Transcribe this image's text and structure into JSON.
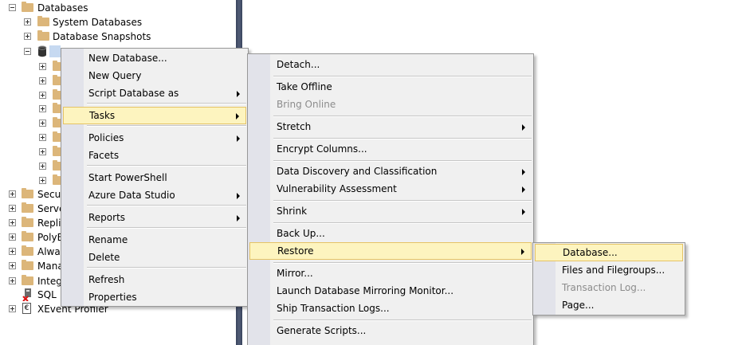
{
  "tree": {
    "nodes": [
      {
        "label": "Databases",
        "expander": "minus",
        "icon": "folder"
      },
      {
        "label": "System Databases",
        "expander": "plus",
        "icon": "folder"
      },
      {
        "label": "Database Snapshots",
        "expander": "plus",
        "icon": "folder"
      },
      {
        "label": "",
        "expander": "minus",
        "icon": "database"
      },
      {
        "label": "",
        "expander": "plus",
        "icon": "folder"
      },
      {
        "label": "",
        "expander": "plus",
        "icon": "folder"
      },
      {
        "label": "",
        "expander": "plus",
        "icon": "folder"
      },
      {
        "label": "",
        "expander": "plus",
        "icon": "folder"
      },
      {
        "label": "",
        "expander": "plus",
        "icon": "folder"
      },
      {
        "label": "",
        "expander": "plus",
        "icon": "folder"
      },
      {
        "label": "",
        "expander": "plus",
        "icon": "folder"
      },
      {
        "label": "",
        "expander": "plus",
        "icon": "folder"
      },
      {
        "label": "",
        "expander": "plus",
        "icon": "folder"
      },
      {
        "label": "Secu",
        "expander": "plus",
        "icon": "folder"
      },
      {
        "label": "Serve",
        "expander": "plus",
        "icon": "folder"
      },
      {
        "label": "Repli",
        "expander": "plus",
        "icon": "folder"
      },
      {
        "label": "PolyB",
        "expander": "plus",
        "icon": "folder"
      },
      {
        "label": "Alwa",
        "expander": "plus",
        "icon": "folder"
      },
      {
        "label": "Mana",
        "expander": "plus",
        "icon": "folder"
      },
      {
        "label": "Integ",
        "expander": "plus",
        "icon": "folder"
      },
      {
        "label": "SQL",
        "expander": "none",
        "icon": "sql-agent-icon"
      },
      {
        "label": "XEvent Profiler",
        "expander": "plus",
        "icon": "xevent-icon"
      }
    ]
  },
  "menu1": {
    "items": [
      {
        "label": "New Database...",
        "submenu": false
      },
      {
        "label": "New Query",
        "submenu": false
      },
      {
        "label": "Script Database as",
        "submenu": true
      },
      {
        "label": "Tasks",
        "submenu": true,
        "highlighted": true
      },
      {
        "label": "Policies",
        "submenu": true
      },
      {
        "label": "Facets",
        "submenu": false
      },
      {
        "label": "Start PowerShell",
        "submenu": false
      },
      {
        "label": "Azure Data Studio",
        "submenu": true
      },
      {
        "label": "Reports",
        "submenu": true
      },
      {
        "label": "Rename",
        "submenu": false
      },
      {
        "label": "Delete",
        "submenu": false
      },
      {
        "label": "Refresh",
        "submenu": false
      },
      {
        "label": "Properties",
        "submenu": false
      }
    ]
  },
  "menu2": {
    "items": [
      {
        "label": "Detach...",
        "submenu": false
      },
      {
        "label": "Take Offline",
        "submenu": false
      },
      {
        "label": "Bring Online",
        "submenu": false,
        "disabled": true
      },
      {
        "label": "Stretch",
        "submenu": true
      },
      {
        "label": "Encrypt Columns...",
        "submenu": false
      },
      {
        "label": "Data Discovery and Classification",
        "submenu": true
      },
      {
        "label": "Vulnerability Assessment",
        "submenu": true
      },
      {
        "label": "Shrink",
        "submenu": true
      },
      {
        "label": "Back Up...",
        "submenu": false
      },
      {
        "label": "Restore",
        "submenu": true,
        "highlighted": true
      },
      {
        "label": "Mirror...",
        "submenu": false
      },
      {
        "label": "Launch Database Mirroring Monitor...",
        "submenu": false
      },
      {
        "label": "Ship Transaction Logs...",
        "submenu": false
      },
      {
        "label": "Generate Scripts...",
        "submenu": false
      }
    ]
  },
  "menu3": {
    "items": [
      {
        "label": "Database...",
        "highlighted": true
      },
      {
        "label": "Files and Filegroups..."
      },
      {
        "label": "Transaction Log...",
        "disabled": true
      },
      {
        "label": "Page..."
      }
    ]
  },
  "colors": {
    "highlight_fill": "#fdf4bf",
    "highlight_border": "#e5c365",
    "menu_background": "#f0f0f0",
    "gutter": "#e2e3ea",
    "folder": "#dcb67a",
    "splitter": "#3f4a63"
  }
}
